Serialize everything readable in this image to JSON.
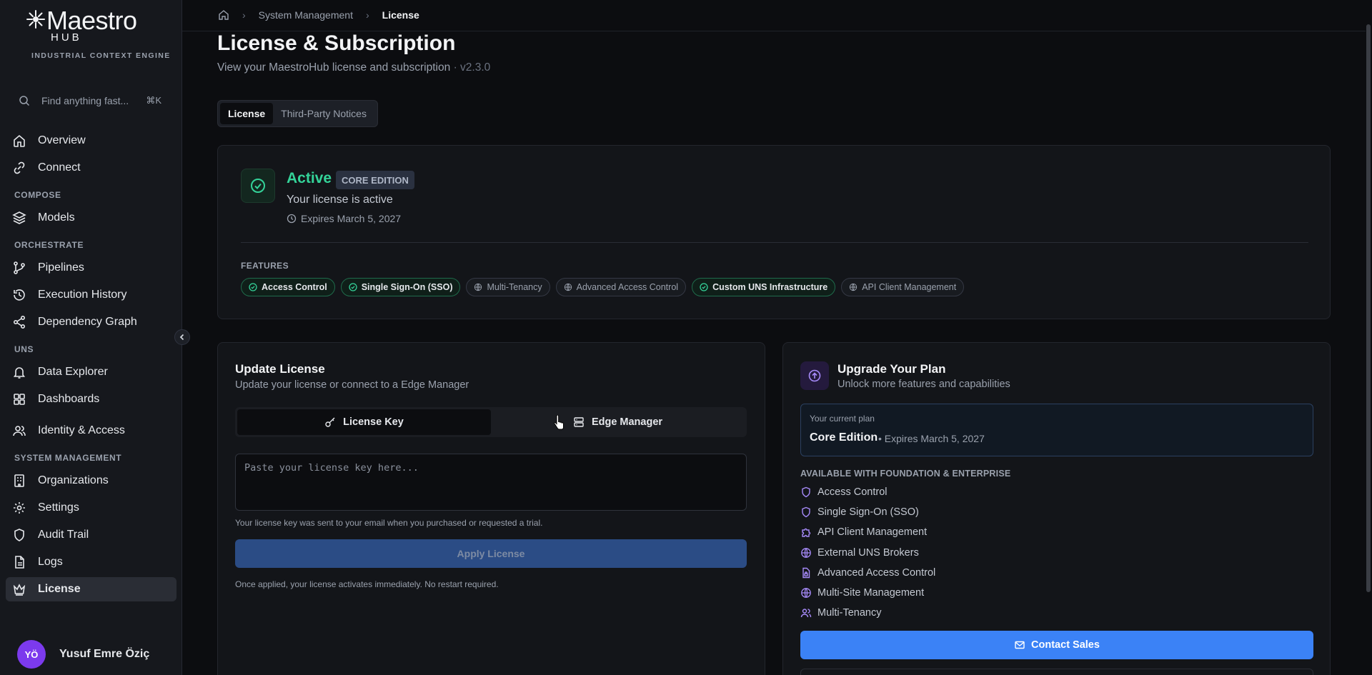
{
  "brand": {
    "name": "Maestro",
    "sub": "HUB",
    "tagline": "INDUSTRIAL CONTEXT ENGINE"
  },
  "search": {
    "placeholder": "Find anything fast...",
    "shortcut": "⌘K"
  },
  "nav": {
    "overview": "Overview",
    "connect": "Connect",
    "section_compose": "COMPOSE",
    "models": "Models",
    "section_orchestrate": "ORCHESTRATE",
    "pipelines": "Pipelines",
    "execution_history": "Execution History",
    "dependency_graph": "Dependency Graph",
    "section_uns": "UNS",
    "data_explorer": "Data Explorer",
    "dashboards": "Dashboards",
    "identity_access": "Identity & Access",
    "section_system": "SYSTEM MANAGEMENT",
    "organizations": "Organizations",
    "settings": "Settings",
    "audit_trail": "Audit Trail",
    "logs": "Logs",
    "license": "License"
  },
  "user": {
    "initials": "YÖ",
    "name": "Yusuf Emre Öziç",
    "avatar_color": "#7c3aed"
  },
  "breadcrumb": {
    "parent": "System Management",
    "current": "License"
  },
  "page": {
    "title": "License & Subscription",
    "subtitle": "View your MaestroHub license and subscription",
    "version": "· v2.3.0"
  },
  "tabs": {
    "license": "License",
    "notices": "Third-Party Notices"
  },
  "status": {
    "state": "Active",
    "edition": "CORE EDITION",
    "message": "Your license is active",
    "expires": "Expires March 5, 2027",
    "accent_color": "#34d399"
  },
  "features": {
    "label": "FEATURES",
    "items": [
      {
        "label": "Access Control",
        "enabled": true,
        "icon": "check-circle-icon"
      },
      {
        "label": "Single Sign-On (SSO)",
        "enabled": true,
        "icon": "check-circle-icon"
      },
      {
        "label": "Multi-Tenancy",
        "enabled": false,
        "icon": "globe-icon"
      },
      {
        "label": "Advanced Access Control",
        "enabled": false,
        "icon": "globe-icon"
      },
      {
        "label": "Custom UNS Infrastructure",
        "enabled": true,
        "icon": "check-circle-icon"
      },
      {
        "label": "API Client Management",
        "enabled": false,
        "icon": "globe-icon"
      }
    ]
  },
  "update": {
    "title": "Update License",
    "subtitle": "Update your license or connect to a Edge Manager",
    "mode_key": "License Key",
    "mode_edge": "Edge Manager",
    "placeholder": "Paste your license key here...",
    "hint": "Your license key was sent to your email when you purchased or requested a trial.",
    "apply": "Apply License",
    "note": "Once applied, your license activates immediately. No restart required."
  },
  "upgrade": {
    "title": "Upgrade Your Plan",
    "subtitle": "Unlock more features and capabilities",
    "current_label": "Your current plan",
    "current_plan": "Core Edition",
    "current_expires": "• Expires March 5, 2027",
    "available_label": "AVAILABLE WITH FOUNDATION & ENTERPRISE",
    "available": [
      {
        "label": "Access Control",
        "icon": "shield-icon"
      },
      {
        "label": "Single Sign-On (SSO)",
        "icon": "shield-icon"
      },
      {
        "label": "API Client Management",
        "icon": "puzzle-icon"
      },
      {
        "label": "External UNS Brokers",
        "icon": "globe-icon"
      },
      {
        "label": "Advanced Access Control",
        "icon": "file-lock-icon"
      },
      {
        "label": "Multi-Site Management",
        "icon": "globe-icon"
      },
      {
        "label": "Multi-Tenancy",
        "icon": "users-icon"
      }
    ],
    "contact": "Contact Sales",
    "accent_color": "#a78bfa",
    "button_color": "#3b82f6"
  }
}
